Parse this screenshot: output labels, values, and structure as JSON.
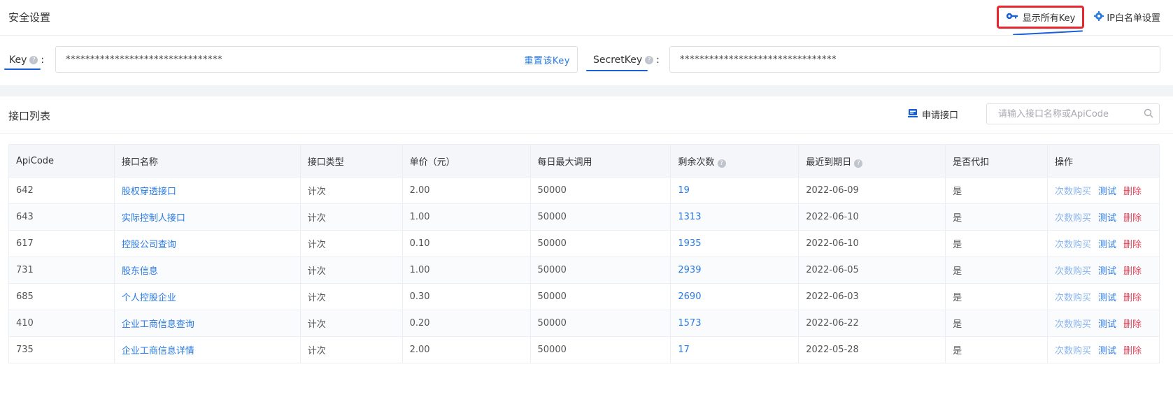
{
  "security": {
    "title": "安全设置",
    "show_all_keys": "显示所有Key",
    "ip_whitelist": "IP白名单设置",
    "key_label": "Key",
    "key_value": "********************************",
    "reset_key": "重置该Key",
    "secret_label": "SecretKey",
    "secret_value": "********************************",
    "colon": ":"
  },
  "api_list": {
    "title": "接口列表",
    "apply_button": "申请接口",
    "search_placeholder": "请输入接口名称或ApiCode",
    "columns": [
      "ApiCode",
      "接口名称",
      "接口类型",
      "单价（元）",
      "每日最大调用",
      "剩余次数",
      "最近到期日",
      "是否代扣",
      "操作"
    ],
    "rows": [
      {
        "code": "642",
        "name": "股权穿透接口",
        "type": "计次",
        "price": "2.00",
        "max": "50000",
        "remain": "19",
        "expire": "2022-06-09",
        "deduct": "是"
      },
      {
        "code": "643",
        "name": "实际控制人接口",
        "type": "计次",
        "price": "1.00",
        "max": "50000",
        "remain": "1313",
        "expire": "2022-06-10",
        "deduct": "是"
      },
      {
        "code": "617",
        "name": "控股公司查询",
        "type": "计次",
        "price": "0.10",
        "max": "50000",
        "remain": "1935",
        "expire": "2022-06-10",
        "deduct": "是"
      },
      {
        "code": "731",
        "name": "股东信息",
        "type": "计次",
        "price": "1.00",
        "max": "50000",
        "remain": "2939",
        "expire": "2022-06-05",
        "deduct": "是"
      },
      {
        "code": "685",
        "name": "个人控股企业",
        "type": "计次",
        "price": "0.30",
        "max": "50000",
        "remain": "2690",
        "expire": "2022-06-03",
        "deduct": "是"
      },
      {
        "code": "410",
        "name": "企业工商信息查询",
        "type": "计次",
        "price": "0.20",
        "max": "50000",
        "remain": "1573",
        "expire": "2022-06-22",
        "deduct": "是"
      },
      {
        "code": "735",
        "name": "企业工商信息详情",
        "type": "计次",
        "price": "2.00",
        "max": "50000",
        "remain": "17",
        "expire": "2022-05-28",
        "deduct": "是"
      }
    ],
    "ops": {
      "buy": "次数购买",
      "test": "测试",
      "delete": "删除"
    }
  },
  "colors": {
    "accent": "#2a7ae2",
    "highlight_box": "#e8262d",
    "annotation": "#1b5fd9",
    "delete": "#e8445a"
  },
  "icons": [
    "key-icon",
    "gear-icon",
    "help-icon",
    "apply-icon",
    "search-icon"
  ]
}
